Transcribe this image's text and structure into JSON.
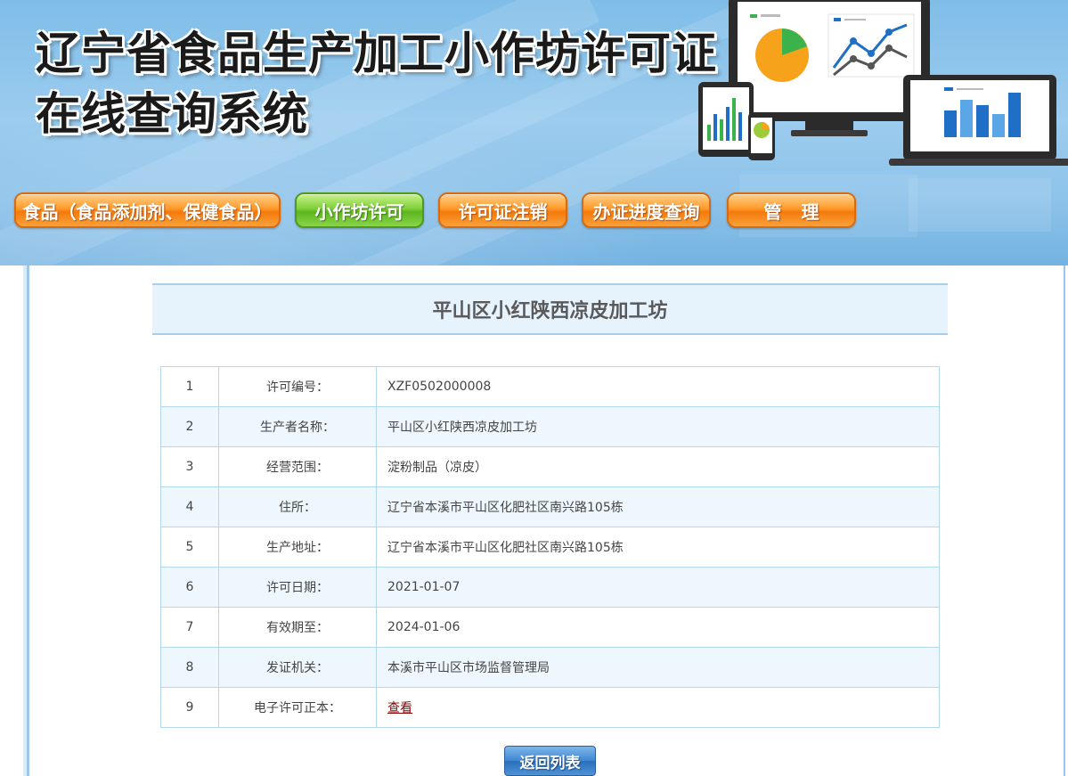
{
  "header": {
    "title_line1": "辽宁省食品生产加工小作坊许可证",
    "title_line2": "在线查询系统"
  },
  "nav": {
    "items": [
      {
        "label": "食品（食品添加剂、保健食品）",
        "active": false
      },
      {
        "label": "小作坊许可",
        "active": true
      },
      {
        "label": "许可证注销",
        "active": false
      },
      {
        "label": "办证进度查询",
        "active": false
      },
      {
        "label": "管理",
        "active": false
      }
    ]
  },
  "page": {
    "heading": "平山区小红陕西凉皮加工坊"
  },
  "table": {
    "rows": [
      {
        "index": "1",
        "label": "许可编号：",
        "value": "XZF0502000008"
      },
      {
        "index": "2",
        "label": "生产者名称：",
        "value": "平山区小红陕西凉皮加工坊"
      },
      {
        "index": "3",
        "label": "经营范围：",
        "value": "淀粉制品（凉皮）"
      },
      {
        "index": "4",
        "label": "住所：",
        "value": "辽宁省本溪市平山区化肥社区南兴路105栋"
      },
      {
        "index": "5",
        "label": "生产地址：",
        "value": "辽宁省本溪市平山区化肥社区南兴路105栋"
      },
      {
        "index": "6",
        "label": "许可日期：",
        "value": "2021-01-07"
      },
      {
        "index": "7",
        "label": "有效期至：",
        "value": "2024-01-06"
      },
      {
        "index": "8",
        "label": "发证机关：",
        "value": "本溪市平山区市场监督管理局"
      },
      {
        "index": "9",
        "label": "电子许可正本：",
        "value": "查看"
      }
    ]
  },
  "back_button": {
    "label": "返回列表"
  },
  "colors": {
    "nav_orange": "#f47a0c",
    "nav_green": "#5cb61e",
    "link_red": "#8b0000",
    "header_blue": "#8ec3ea"
  }
}
